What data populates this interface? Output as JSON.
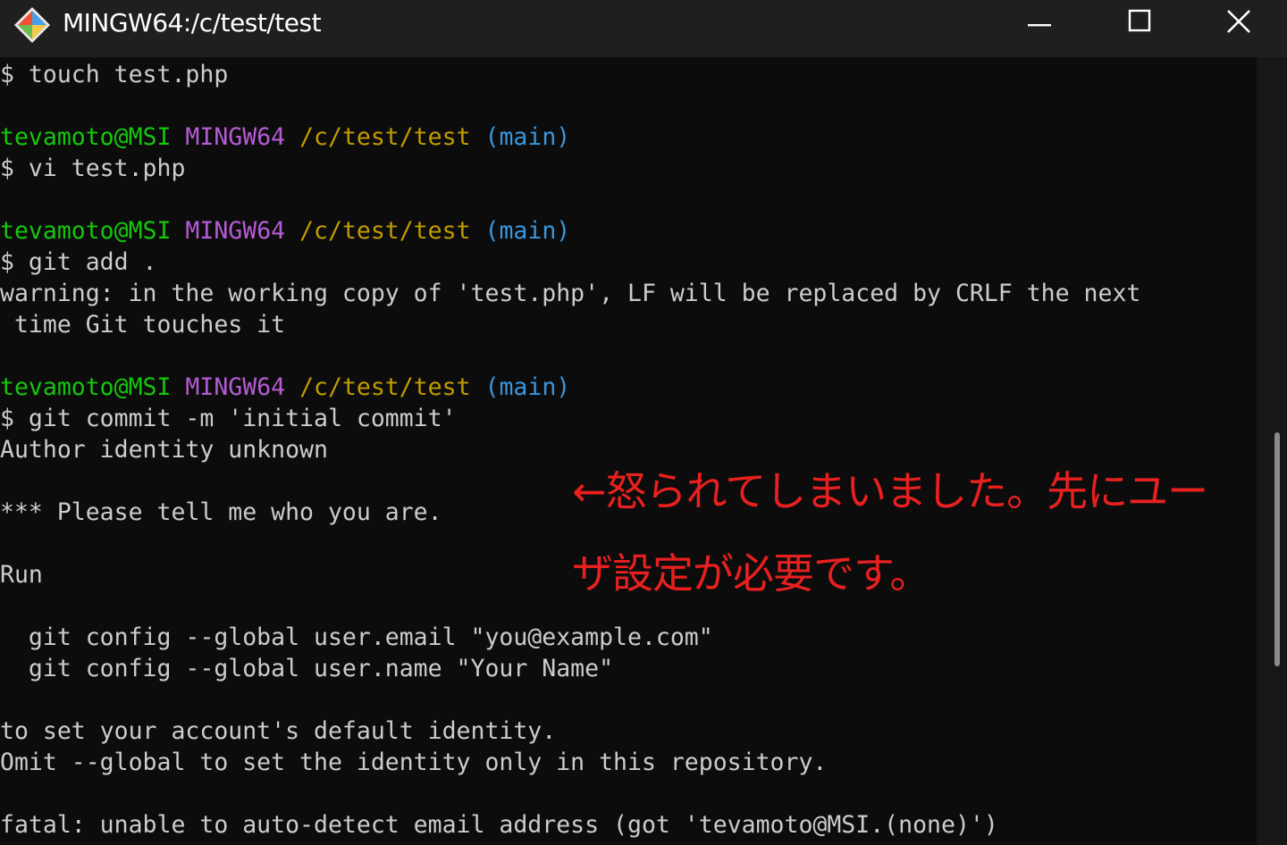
{
  "window": {
    "title": "MINGW64:/c/test/test",
    "icon": "git-bash-diamond-icon",
    "controls": {
      "minimize_icon": "minimize-icon",
      "maximize_icon": "maximize-icon",
      "close_icon": "close-icon"
    }
  },
  "colors": {
    "background": "#0c0c0c",
    "titlebar": "#1f1f1f",
    "text": "#cccccc",
    "user_host": "#16c60c",
    "mingw": "#b55bd4",
    "path": "#c19c00",
    "branch": "#3a96dd",
    "annotation": "#e8201f"
  },
  "terminal": {
    "line1": "$ touch test.php",
    "prompt1": {
      "user_host": "tevamoto@MSI",
      "env": "MINGW64",
      "path": "/c/test/test",
      "branch": "(main)"
    },
    "line2": "$ vi test.php",
    "prompt2": {
      "user_host": "tevamoto@MSI",
      "env": "MINGW64",
      "path": "/c/test/test",
      "branch": "(main)"
    },
    "line3": "$ git add .",
    "line4": "warning: in the working copy of 'test.php', LF will be replaced by CRLF the next",
    "line5": " time Git touches it",
    "prompt3": {
      "user_host": "tevamoto@MSI",
      "env": "MINGW64",
      "path": "/c/test/test",
      "branch": "(main)"
    },
    "line6": "$ git commit -m 'initial commit'",
    "line7": "Author identity unknown",
    "line8": "*** Please tell me who you are.",
    "line9": "Run",
    "line10": "  git config --global user.email \"you@example.com\"",
    "line11": "  git config --global user.name \"Your Name\"",
    "line12": "to set your account's default identity.",
    "line13": "Omit --global to set the identity only in this repository.",
    "line14": "fatal: unable to auto-detect email address (got 'tevamoto@MSI.(none)')"
  },
  "annotation": {
    "line1": "←怒られてしまいました。先にユー",
    "line2": "ザ設定が必要です。"
  }
}
